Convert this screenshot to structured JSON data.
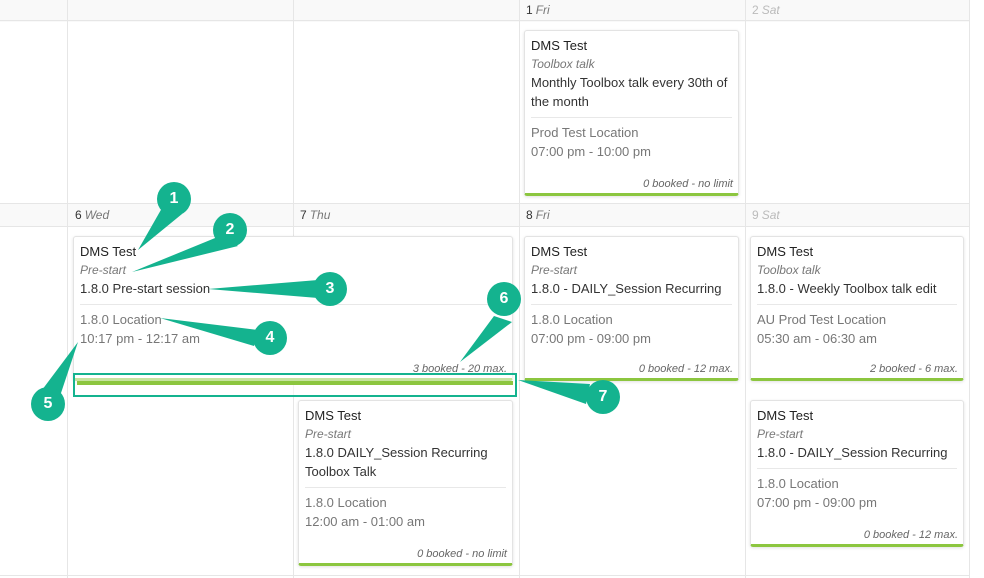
{
  "days": {
    "fri1": {
      "num": "1",
      "name": "Fri"
    },
    "sat2": {
      "num": "2",
      "name": "Sat"
    },
    "wed6": {
      "num": "6",
      "name": "Wed"
    },
    "thu7": {
      "num": "7",
      "name": "Thu"
    },
    "fri8": {
      "num": "8",
      "name": "Fri"
    },
    "sat9": {
      "num": "9",
      "name": "Sat"
    }
  },
  "events": {
    "e1": {
      "title": "DMS Test",
      "type": "Toolbox talk",
      "desc": "Monthly Toolbox talk every 30th of the month",
      "location": "Prod Test Location",
      "time": "07:00 pm - 10:00 pm",
      "booked": "0 booked - no limit"
    },
    "e2": {
      "title": "DMS Test",
      "type": "Pre-start",
      "desc": "1.8.0 Pre-start session",
      "location": "1.8.0 Location",
      "time": "10:17 pm - 12:17 am",
      "booked": "3 booked - 20 max."
    },
    "e3": {
      "title": "DMS Test",
      "type": "Pre-start",
      "desc": "1.8.0 - DAILY_Session Recurring",
      "location": "1.8.0 Location",
      "time": "07:00 pm - 09:00 pm",
      "booked": "0 booked - 12 max."
    },
    "e4": {
      "title": "DMS Test",
      "type": "Toolbox talk",
      "desc": "1.8.0 - Weekly Toolbox talk edit",
      "location": "AU Prod Test Location",
      "time": "05:30 am - 06:30 am",
      "booked": "2 booked - 6 max."
    },
    "e5": {
      "title": "DMS Test",
      "type": "Pre-start",
      "desc": "1.8.0 DAILY_Session Recurring Toolbox Talk",
      "location": "1.8.0 Location",
      "time": "12:00 am - 01:00 am",
      "booked": "0 booked - no limit"
    },
    "e6": {
      "title": "DMS Test",
      "type": "Pre-start",
      "desc": "1.8.0 - DAILY_Session Recurring",
      "location": "1.8.0 Location",
      "time": "07:00 pm - 09:00 pm",
      "booked": "0 booked - 12 max."
    }
  },
  "callouts": [
    "1",
    "2",
    "3",
    "4",
    "5",
    "6",
    "7"
  ],
  "colors": {
    "accent": "#14b38f",
    "bar": "#8cc63f"
  }
}
